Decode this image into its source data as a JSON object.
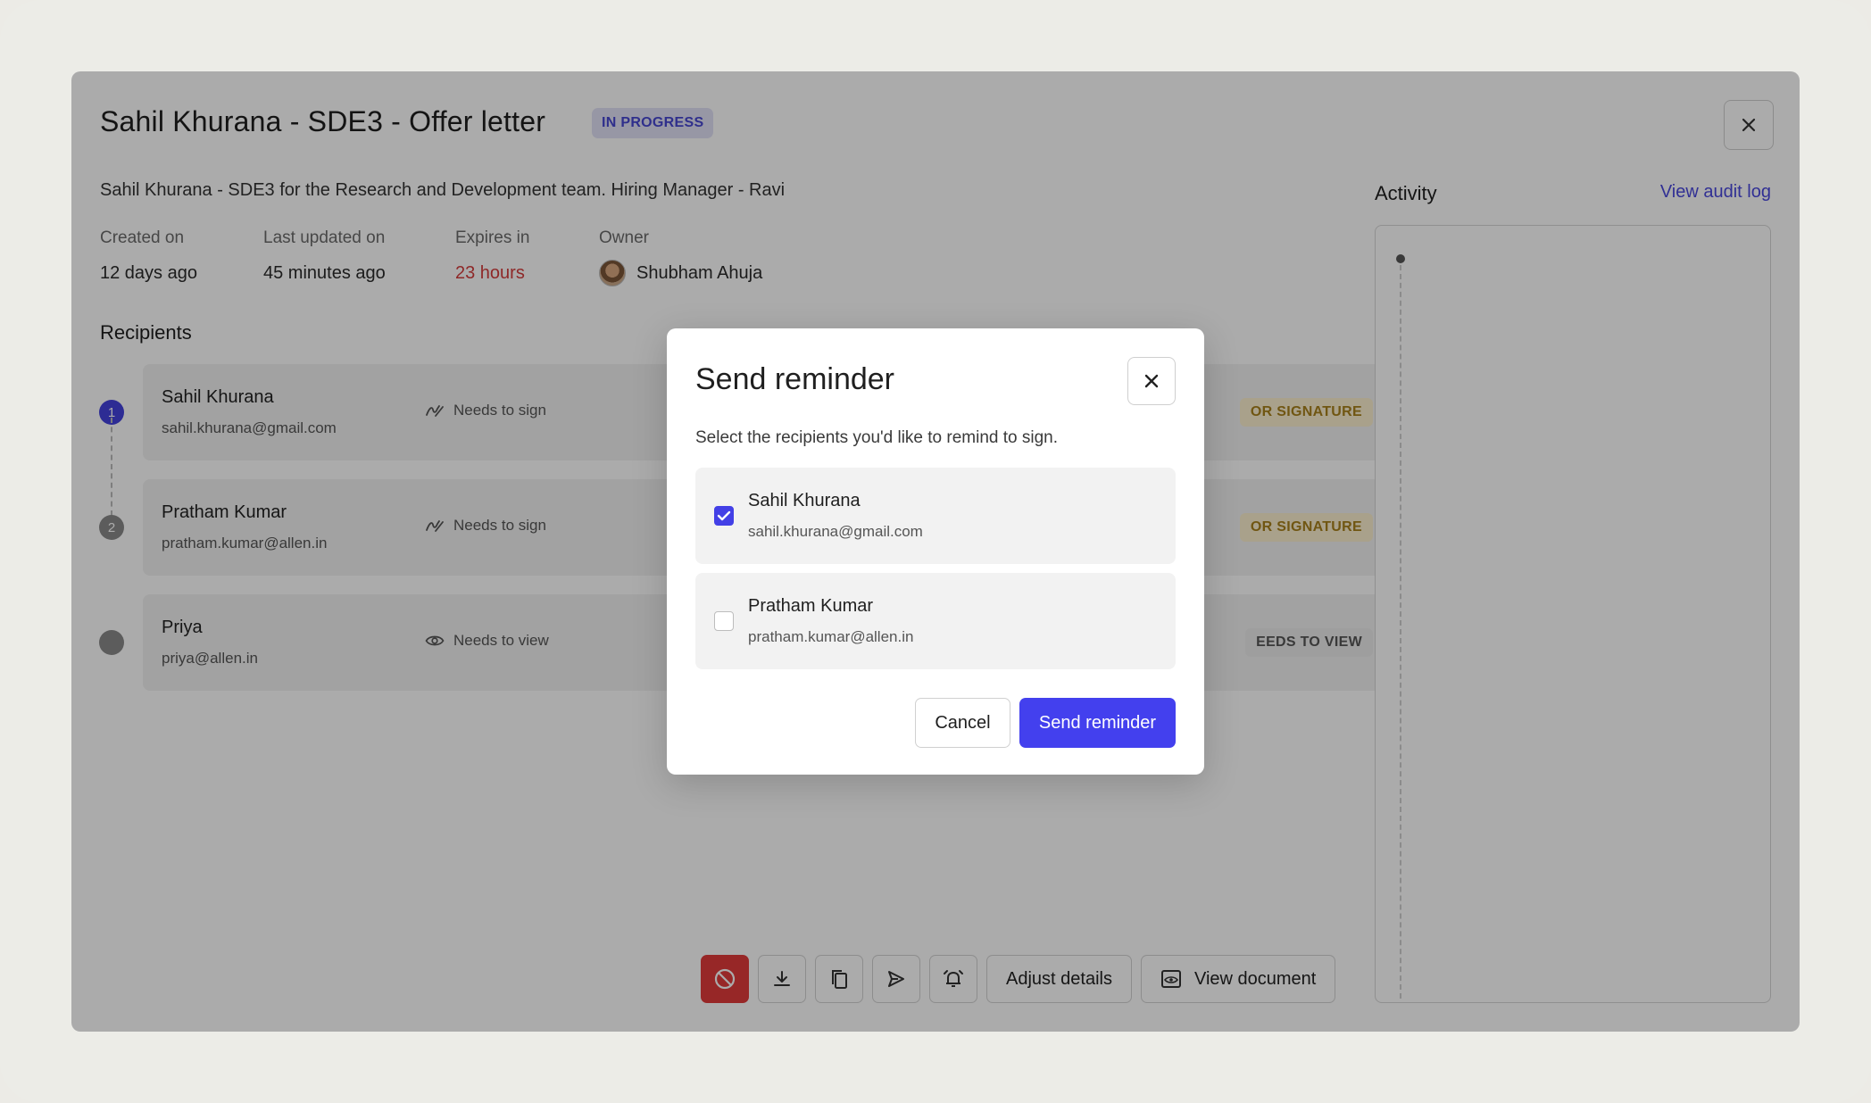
{
  "document": {
    "title": "Sahil Khurana - SDE3 - Offer letter",
    "status": "IN PROGRESS",
    "description": "Sahil Khurana - SDE3 for the Research and Development team. Hiring Manager - Ravi",
    "meta": {
      "created_label": "Created on",
      "created_value": "12 days ago",
      "updated_label": "Last updated on",
      "updated_value": "45 minutes ago",
      "expires_label": "Expires in",
      "expires_value": "23 hours",
      "owner_label": "Owner",
      "owner_name": "Shubham Ahuja"
    }
  },
  "recipients": {
    "title": "Recipients",
    "items": [
      {
        "step": "1",
        "name": "Sahil Khurana",
        "email": "sahil.khurana@gmail.com",
        "role": "Needs to sign",
        "status": "OR SIGNATURE"
      },
      {
        "step": "2",
        "name": "Pratham Kumar",
        "email": "pratham.kumar@allen.in",
        "role": "Needs to sign",
        "status": "OR SIGNATURE"
      },
      {
        "step": "",
        "name": "Priya",
        "email": "priya@allen.in",
        "role": "Needs to view",
        "status": "EEDS TO VIEW"
      }
    ]
  },
  "activity": {
    "title": "Activity",
    "audit_link": "View audit log"
  },
  "toolbar": {
    "adjust_label": "Adjust details",
    "view_label": "View document",
    "icons": [
      "cancel-icon",
      "download-icon",
      "copy-icon",
      "send-icon",
      "bell-icon",
      "eye-document-icon"
    ]
  },
  "modal": {
    "title": "Send reminder",
    "description": "Select the recipients you'd like to remind to sign.",
    "options": [
      {
        "name": "Sahil Khurana",
        "email": "sahil.khurana@gmail.com",
        "checked": true
      },
      {
        "name": "Pratham Kumar",
        "email": "pratham.kumar@allen.in",
        "checked": false
      }
    ],
    "cancel_label": "Cancel",
    "send_label": "Send reminder"
  },
  "colors": {
    "accent": "#4340ee",
    "danger": "#e23b3b",
    "expires": "#d43d3d",
    "status_badge": "#4746d1"
  }
}
